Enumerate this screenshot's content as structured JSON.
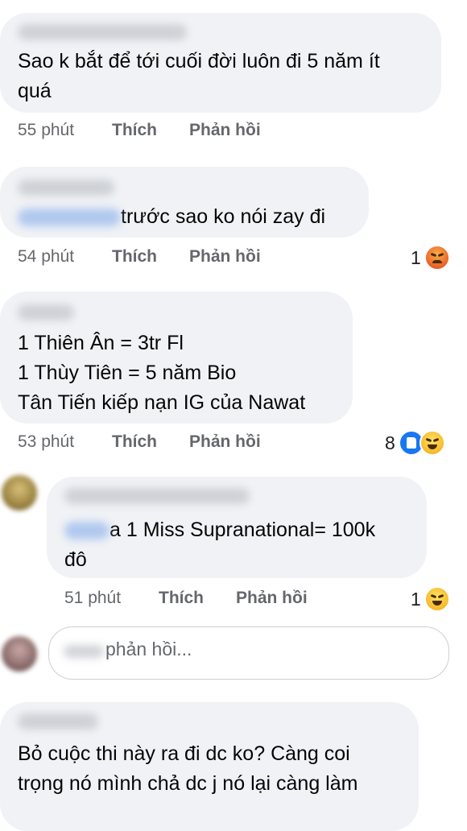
{
  "comments": [
    {
      "author": "Hoàng Thị Phương",
      "text": [
        "Sao k bắt để tới cuối đời luôn đi 5 năm ít",
        "quá"
      ],
      "time": "55 phút",
      "like_label": "Thích",
      "reply_label": "Phản hồi"
    },
    {
      "author": "Thùy Ngân",
      "mention": "Phạm Anh",
      "text": [
        "trước sao ko nói zay đi"
      ],
      "time": "54 phút",
      "like_label": "Thích",
      "reply_label": "Phản hồi",
      "reaction_count": "1",
      "reactions": [
        "angry-emoji-icon"
      ]
    },
    {
      "author": "Lý Vân",
      "text": [
        "1 Thiên Ân = 3tr Fl",
        "1 Thùy Tiên = 5 năm Bio",
        "Tân Tiến kiếp nạn IG của Nawat"
      ],
      "time": "53 phút",
      "like_label": "Thích",
      "reply_label": "Phản hồi",
      "reaction_count": "8",
      "reactions": [
        "like-emoji-icon",
        "haha-emoji-icon"
      ]
    }
  ],
  "reply": {
    "author": "Nguyễn Huỳnh",
    "mention": "Lý Vân",
    "mention_tail": "a",
    "text": [
      "1 Miss Supranational= 100k",
      "đô"
    ],
    "time": "51 phút",
    "like_label": "Thích",
    "reply_label": "Phản hồi",
    "reaction_count": "1",
    "reactions": [
      "haha-emoji-icon"
    ]
  },
  "reply_input": {
    "placeholder": "phản hồi..."
  },
  "last_comment": {
    "author": "Trần Lâm",
    "text": [
      "Bỏ cuộc thi này ra đi dc ko? Càng coi",
      "trọng nó mình chả dc j nó lại càng làm"
    ]
  },
  "colors": {
    "bubble": "#f0f2f5",
    "meta_text": "#65676b",
    "like_blue": "#1877f2"
  }
}
